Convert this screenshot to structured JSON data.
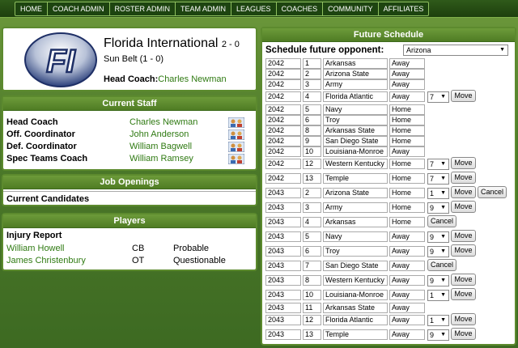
{
  "nav": [
    "HOME",
    "COACH ADMIN",
    "ROSTER ADMIN",
    "TEAM ADMIN",
    "LEAGUES",
    "COACHES",
    "COMMUNITY",
    "AFFILIATES"
  ],
  "team": {
    "logo_text": "FI",
    "name": "Florida International",
    "record": "2 - 0",
    "conference": "Sun Belt (1 - 0)",
    "head_coach_label": "Head Coach:",
    "head_coach_name": "Charles Newman"
  },
  "staff": {
    "title": "Current Staff",
    "rows": [
      {
        "role": "Head Coach",
        "name": "Charles Newman"
      },
      {
        "role": "Off. Coordinator",
        "name": "John Anderson"
      },
      {
        "role": "Def. Coordinator",
        "name": "William Bagwell"
      },
      {
        "role": "Spec Teams Coach",
        "name": "William Ramsey"
      }
    ]
  },
  "jobs": {
    "title": "Job Openings",
    "candidates_label": "Current Candidates"
  },
  "players": {
    "title": "Players",
    "injury_label": "Injury Report",
    "injuries": [
      {
        "name": "William Howell",
        "pos": "CB",
        "status": "Probable"
      },
      {
        "name": "James Christenbury",
        "pos": "OT",
        "status": "Questionable"
      }
    ]
  },
  "schedule": {
    "title": "Future Schedule",
    "opponent_label": "Schedule future opponent:",
    "opponent_value": "Arizona",
    "move_label": "Move",
    "cancel_label": "Cancel",
    "rows": [
      {
        "year": "2042",
        "week": "1",
        "team": "Arkansas",
        "ha": "Away"
      },
      {
        "year": "2042",
        "week": "2",
        "team": "Arizona State",
        "ha": "Away"
      },
      {
        "year": "2042",
        "week": "3",
        "team": "Army",
        "ha": "Away"
      },
      {
        "year": "2042",
        "week": "4",
        "team": "Florida Atlantic",
        "ha": "Away",
        "sel": "7",
        "move": true
      },
      {
        "year": "2042",
        "week": "5",
        "team": "Navy",
        "ha": "Home"
      },
      {
        "year": "2042",
        "week": "6",
        "team": "Troy",
        "ha": "Home"
      },
      {
        "year": "2042",
        "week": "8",
        "team": "Arkansas State",
        "ha": "Home"
      },
      {
        "year": "2042",
        "week": "9",
        "team": "San Diego State",
        "ha": "Home"
      },
      {
        "year": "2042",
        "week": "10",
        "team": "Louisiana-Monroe",
        "ha": "Away"
      },
      {
        "year": "2042",
        "week": "12",
        "team": "Western Kentucky",
        "ha": "Home",
        "sel": "7",
        "move": true
      },
      {
        "year": "2042",
        "week": "13",
        "team": "Temple",
        "ha": "Home",
        "sel": "7",
        "move": true
      },
      {
        "year": "2043",
        "week": "2",
        "team": "Arizona State",
        "ha": "Home",
        "sel": "1",
        "move": true,
        "cancel2": true
      },
      {
        "year": "2043",
        "week": "3",
        "team": "Army",
        "ha": "Home",
        "sel": "9",
        "move": true
      },
      {
        "year": "2043",
        "week": "4",
        "team": "Arkansas",
        "ha": "Home",
        "cancel1": true
      },
      {
        "year": "2043",
        "week": "5",
        "team": "Navy",
        "ha": "Away",
        "sel": "9",
        "move": true
      },
      {
        "year": "2043",
        "week": "6",
        "team": "Troy",
        "ha": "Away",
        "sel": "9",
        "move": true
      },
      {
        "year": "2043",
        "week": "7",
        "team": "San Diego State",
        "ha": "Away",
        "cancel1": true
      },
      {
        "year": "2043",
        "week": "8",
        "team": "Western Kentucky",
        "ha": "Away",
        "sel": "9",
        "move": true
      },
      {
        "year": "2043",
        "week": "10",
        "team": "Louisiana-Monroe",
        "ha": "Away",
        "sel": "1",
        "move": true
      },
      {
        "year": "2043",
        "week": "11",
        "team": "Arkansas State",
        "ha": "Away"
      },
      {
        "year": "2043",
        "week": "12",
        "team": "Florida Atlantic",
        "ha": "Away",
        "sel": "1",
        "move": true
      },
      {
        "year": "2043",
        "week": "13",
        "team": "Temple",
        "ha": "Away",
        "sel": "9",
        "move": true
      }
    ]
  },
  "colors": {
    "accent_green": "#4f7c24",
    "link_green": "#2f7a12"
  }
}
